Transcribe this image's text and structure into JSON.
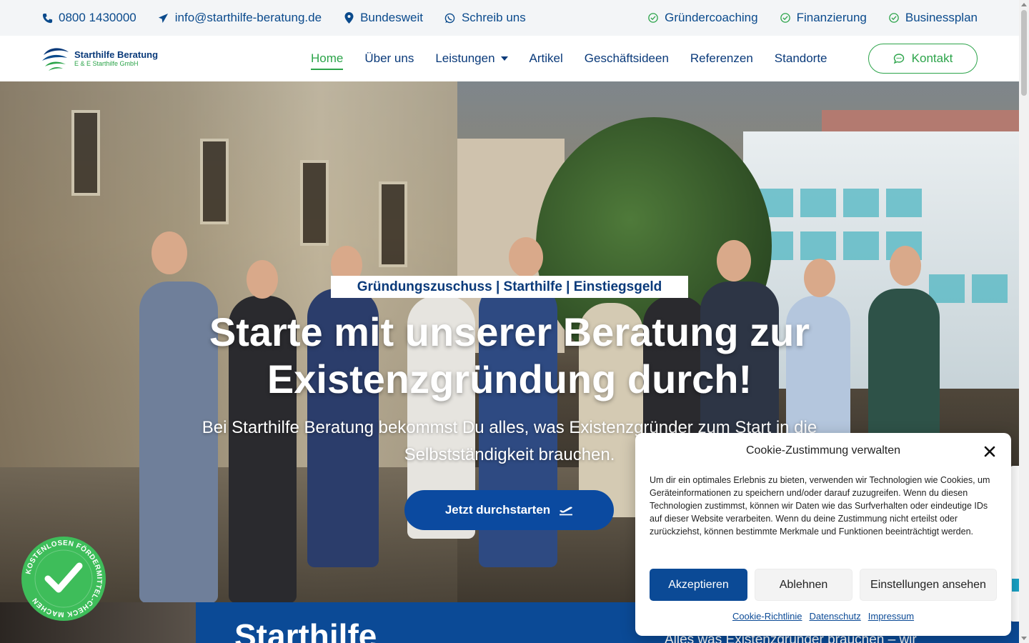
{
  "topbar": {
    "phone": "0800 1430000",
    "email": "info@starthilfe-beratung.de",
    "location": "Bundesweit",
    "whatsapp": "Schreib uns",
    "features": [
      "Gründercoaching",
      "Finanzierung",
      "Businessplan"
    ]
  },
  "header": {
    "logo_title": "Starthilfe Beratung",
    "logo_sub": "E & E Starthilfe GmbH",
    "nav": [
      "Home",
      "Über uns",
      "Leistungen",
      "Artikel",
      "Geschäftsideen",
      "Referenzen",
      "Standorte"
    ],
    "active_nav": "Home",
    "contact_label": "Kontakt"
  },
  "hero": {
    "tag": "Gründungszuschuss | Starthilfe | Einstiegsgeld",
    "title": "Starte mit unserer Beratung zur Existenzgründung durch!",
    "subtitle": "Bei Starthilfe Beratung bekommst Du alles, was Existenzgründer zum Start in die Selbstständigkeit brauchen.",
    "cta_label": "Jetzt durchstarten"
  },
  "badge": {
    "text": "KOSTENLOSEN FÖRDERMITTEL-CHECK MACHEN"
  },
  "below": {
    "title": "Starthilfe",
    "text": "Alles was Existenzgründer brauchen – wir"
  },
  "cookie": {
    "title": "Cookie-Zustimmung verwalten",
    "body": "Um dir ein optimales Erlebnis zu bieten, verwenden wir Technologien wie Cookies, um Geräteinformationen zu speichern und/oder darauf zuzugreifen. Wenn du diesen Technologien zustimmst, können wir Daten wie das Surfverhalten oder eindeutige IDs auf dieser Website verarbeiten. Wenn du deine Zustimmung nicht erteilst oder zurückziehst, können bestimmte Merkmale und Funktionen beeinträchtigt werden.",
    "accept": "Akzeptieren",
    "deny": "Ablehnen",
    "settings": "Einstellungen ansehen",
    "links": [
      "Cookie-Richtlinie",
      "Datenschutz",
      "Impressum"
    ]
  },
  "colors": {
    "primary_blue": "#0b4a96",
    "accent_green": "#2ca44a",
    "navy_text": "#0a3a7a"
  },
  "icons": {
    "phone": "phone-icon",
    "email": "paper-plane-icon",
    "location": "map-pin-icon",
    "whatsapp": "whatsapp-icon",
    "check": "check-circle-icon",
    "chat": "chat-bubble-icon",
    "plane": "plane-departure-icon",
    "close": "close-icon"
  }
}
